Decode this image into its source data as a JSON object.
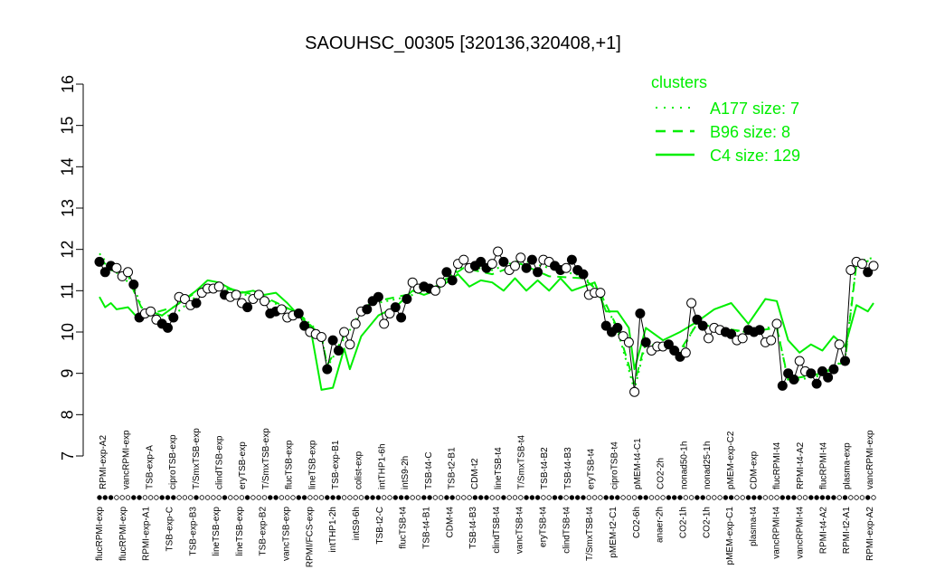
{
  "chart_data": {
    "type": "line",
    "title": "SAOUHSC_00305 [320136,320408,+1]",
    "xlabel": "",
    "ylabel": "",
    "ylim": [
      7,
      16
    ],
    "yticks": [
      "7",
      "8",
      "9",
      "10",
      "11",
      "12",
      "13",
      "14",
      "15",
      "16"
    ],
    "grid": false,
    "legend": {
      "placement": "top-right",
      "title": "clusters",
      "entries": [
        {
          "label": "A177 size: 7",
          "style": "dotted"
        },
        {
          "label": "B96 size: 8",
          "style": "dashed"
        },
        {
          "label": "C4 size: 129",
          "style": "solid"
        }
      ]
    },
    "colors": {
      "series": "#00ee00",
      "points_filled": "#000000",
      "points_open": "#ffffff"
    },
    "top_labels": [
      "RPMI-exp-A2",
      "vancRPMI-exp",
      "TSB-exp-A",
      "ciproTSB-exp",
      "T/SmxTSB-exp",
      "clindTSB-exp",
      "eryTSB-exp",
      "T/SmxTSB-exp",
      "flucTSB-exp",
      "lineTSB-exp",
      "TSB-exp-B1",
      "colist-exp",
      "intTHP1-6h",
      "intS9-2h",
      "TSB-t4-C",
      "TSB-t2-B1",
      "CDM-t2",
      "lineTSB-t4",
      "T/SmxTSB-t4",
      "TSB-t4-B2",
      "TSB-t4-B3",
      "eryTSB-t4",
      "ciproTSB-t4",
      "pMEM-t4-C1",
      "CO2-2h",
      "nonad50-1h",
      "nonad25-1h",
      "pMEM-exp-C2",
      "CDM-exp",
      "flucRPMI-t4",
      "RPMI-t4-A2",
      "flucRPMI-t4",
      "plasma-exp",
      "vancRPMI-exp"
    ],
    "bottom_labels": [
      "flucRPMI-exp",
      "flucRPMI-exp",
      "RPMI-exp-A1",
      "TSB-exp-C",
      "TSB-exp-B3",
      "lineTSB-exp",
      "lineTSB-exp",
      "TSB-exp-B2",
      "vancTSB-exp",
      "RPMI/FCS-exp",
      "intTHP1-2h",
      "intS9-6h",
      "TSB-t2-C",
      "flucTSB-t4",
      "TSB-t4-B1",
      "CDM-t4",
      "TSB-t4-B3",
      "clindTSB-t4",
      "vancTSB-t4",
      "eryTSB-t4",
      "clindTSB-t4",
      "T/SmxTSB-t4",
      "pMEM-t2-C1",
      "CO2-6h",
      "anaer-2h",
      "CO2-1h",
      "CO2-1h",
      "pMEM-exp-C1",
      "plasma-t4",
      "vancRPMI-t4",
      "vancRPMI-t4",
      "RPMI-t4-A2",
      "RPMI-t2-A1",
      "RPMI-exp-A2"
    ],
    "points": [
      {
        "x": 1,
        "y": 11.7,
        "f": 1
      },
      {
        "x": 2,
        "y": 11.45,
        "f": 1
      },
      {
        "x": 3,
        "y": 11.6,
        "f": 1
      },
      {
        "x": 4,
        "y": 11.55,
        "f": 0
      },
      {
        "x": 5,
        "y": 11.35,
        "f": 0
      },
      {
        "x": 6,
        "y": 11.45,
        "f": 0
      },
      {
        "x": 7,
        "y": 11.15,
        "f": 1
      },
      {
        "x": 8,
        "y": 10.35,
        "f": 1
      },
      {
        "x": 9,
        "y": 10.45,
        "f": 0
      },
      {
        "x": 10,
        "y": 10.5,
        "f": 0
      },
      {
        "x": 11,
        "y": 10.3,
        "f": 0
      },
      {
        "x": 12,
        "y": 10.2,
        "f": 1
      },
      {
        "x": 13,
        "y": 10.1,
        "f": 1
      },
      {
        "x": 14,
        "y": 10.35,
        "f": 1
      },
      {
        "x": 15,
        "y": 10.85,
        "f": 0
      },
      {
        "x": 16,
        "y": 10.8,
        "f": 0
      },
      {
        "x": 17,
        "y": 10.65,
        "f": 0
      },
      {
        "x": 18,
        "y": 10.7,
        "f": 1
      },
      {
        "x": 19,
        "y": 10.95,
        "f": 0
      },
      {
        "x": 20,
        "y": 11.05,
        "f": 0
      },
      {
        "x": 21,
        "y": 11.05,
        "f": 0
      },
      {
        "x": 22,
        "y": 11.1,
        "f": 0
      },
      {
        "x": 23,
        "y": 10.9,
        "f": 1
      },
      {
        "x": 24,
        "y": 10.85,
        "f": 0
      },
      {
        "x": 25,
        "y": 10.9,
        "f": 0
      },
      {
        "x": 26,
        "y": 10.7,
        "f": 0
      },
      {
        "x": 27,
        "y": 10.6,
        "f": 1
      },
      {
        "x": 28,
        "y": 10.8,
        "f": 0
      },
      {
        "x": 29,
        "y": 10.9,
        "f": 0
      },
      {
        "x": 30,
        "y": 10.75,
        "f": 0
      },
      {
        "x": 31,
        "y": 10.45,
        "f": 1
      },
      {
        "x": 32,
        "y": 10.5,
        "f": 1
      },
      {
        "x": 33,
        "y": 10.55,
        "f": 0
      },
      {
        "x": 34,
        "y": 10.35,
        "f": 0
      },
      {
        "x": 35,
        "y": 10.4,
        "f": 0
      },
      {
        "x": 36,
        "y": 10.45,
        "f": 1
      },
      {
        "x": 37,
        "y": 10.15,
        "f": 1
      },
      {
        "x": 38,
        "y": 10.0,
        "f": 0
      },
      {
        "x": 39,
        "y": 9.95,
        "f": 0
      },
      {
        "x": 40,
        "y": 9.88,
        "f": 0
      },
      {
        "x": 41,
        "y": 9.1,
        "f": 1
      },
      {
        "x": 42,
        "y": 9.8,
        "f": 1
      },
      {
        "x": 43,
        "y": 9.55,
        "f": 1
      },
      {
        "x": 44,
        "y": 10.0,
        "f": 0
      },
      {
        "x": 45,
        "y": 9.7,
        "f": 0
      },
      {
        "x": 46,
        "y": 10.2,
        "f": 0
      },
      {
        "x": 47,
        "y": 10.5,
        "f": 0
      },
      {
        "x": 48,
        "y": 10.55,
        "f": 1
      },
      {
        "x": 49,
        "y": 10.75,
        "f": 1
      },
      {
        "x": 50,
        "y": 10.85,
        "f": 1
      },
      {
        "x": 51,
        "y": 10.2,
        "f": 0
      },
      {
        "x": 52,
        "y": 10.45,
        "f": 0
      },
      {
        "x": 53,
        "y": 10.6,
        "f": 1
      },
      {
        "x": 54,
        "y": 10.35,
        "f": 1
      },
      {
        "x": 55,
        "y": 10.8,
        "f": 1
      },
      {
        "x": 56,
        "y": 11.2,
        "f": 0
      },
      {
        "x": 57,
        "y": 11.05,
        "f": 0
      },
      {
        "x": 58,
        "y": 11.1,
        "f": 1
      },
      {
        "x": 59,
        "y": 11.05,
        "f": 1
      },
      {
        "x": 60,
        "y": 11.0,
        "f": 0
      },
      {
        "x": 61,
        "y": 11.2,
        "f": 0
      },
      {
        "x": 62,
        "y": 11.45,
        "f": 1
      },
      {
        "x": 63,
        "y": 11.25,
        "f": 1
      },
      {
        "x": 64,
        "y": 11.65,
        "f": 0
      },
      {
        "x": 65,
        "y": 11.75,
        "f": 0
      },
      {
        "x": 66,
        "y": 11.55,
        "f": 0
      },
      {
        "x": 67,
        "y": 11.6,
        "f": 1
      },
      {
        "x": 68,
        "y": 11.7,
        "f": 1
      },
      {
        "x": 69,
        "y": 11.55,
        "f": 1
      },
      {
        "x": 70,
        "y": 11.65,
        "f": 0
      },
      {
        "x": 71,
        "y": 11.95,
        "f": 0
      },
      {
        "x": 72,
        "y": 11.7,
        "f": 1
      },
      {
        "x": 73,
        "y": 11.5,
        "f": 0
      },
      {
        "x": 74,
        "y": 11.6,
        "f": 0
      },
      {
        "x": 75,
        "y": 11.8,
        "f": 0
      },
      {
        "x": 76,
        "y": 11.55,
        "f": 1
      },
      {
        "x": 77,
        "y": 11.75,
        "f": 1
      },
      {
        "x": 78,
        "y": 11.45,
        "f": 1
      },
      {
        "x": 79,
        "y": 11.75,
        "f": 0
      },
      {
        "x": 80,
        "y": 11.7,
        "f": 0
      },
      {
        "x": 81,
        "y": 11.6,
        "f": 1
      },
      {
        "x": 82,
        "y": 11.5,
        "f": 1
      },
      {
        "x": 83,
        "y": 11.55,
        "f": 0
      },
      {
        "x": 84,
        "y": 11.75,
        "f": 1
      },
      {
        "x": 85,
        "y": 11.5,
        "f": 1
      },
      {
        "x": 86,
        "y": 11.4,
        "f": 1
      },
      {
        "x": 87,
        "y": 10.9,
        "f": 0
      },
      {
        "x": 88,
        "y": 10.95,
        "f": 0
      },
      {
        "x": 89,
        "y": 10.95,
        "f": 0
      },
      {
        "x": 90,
        "y": 10.15,
        "f": 1
      },
      {
        "x": 91,
        "y": 10.0,
        "f": 1
      },
      {
        "x": 92,
        "y": 10.1,
        "f": 1
      },
      {
        "x": 93,
        "y": 9.9,
        "f": 0
      },
      {
        "x": 94,
        "y": 9.75,
        "f": 0
      },
      {
        "x": 95,
        "y": 8.55,
        "f": 0
      },
      {
        "x": 96,
        "y": 10.45,
        "f": 1
      },
      {
        "x": 97,
        "y": 9.75,
        "f": 1
      },
      {
        "x": 98,
        "y": 9.55,
        "f": 0
      },
      {
        "x": 99,
        "y": 9.65,
        "f": 0
      },
      {
        "x": 100,
        "y": 9.65,
        "f": 0
      },
      {
        "x": 101,
        "y": 9.7,
        "f": 1
      },
      {
        "x": 102,
        "y": 9.55,
        "f": 1
      },
      {
        "x": 103,
        "y": 9.4,
        "f": 1
      },
      {
        "x": 104,
        "y": 9.5,
        "f": 0
      },
      {
        "x": 105,
        "y": 10.7,
        "f": 0
      },
      {
        "x": 106,
        "y": 10.3,
        "f": 1
      },
      {
        "x": 107,
        "y": 10.15,
        "f": 1
      },
      {
        "x": 108,
        "y": 9.85,
        "f": 0
      },
      {
        "x": 109,
        "y": 10.1,
        "f": 0
      },
      {
        "x": 110,
        "y": 10.05,
        "f": 0
      },
      {
        "x": 111,
        "y": 10.0,
        "f": 1
      },
      {
        "x": 112,
        "y": 9.95,
        "f": 1
      },
      {
        "x": 113,
        "y": 9.8,
        "f": 0
      },
      {
        "x": 114,
        "y": 9.85,
        "f": 0
      },
      {
        "x": 115,
        "y": 10.05,
        "f": 1
      },
      {
        "x": 116,
        "y": 10.0,
        "f": 1
      },
      {
        "x": 117,
        "y": 10.05,
        "f": 1
      },
      {
        "x": 118,
        "y": 9.75,
        "f": 0
      },
      {
        "x": 119,
        "y": 9.8,
        "f": 0
      },
      {
        "x": 120,
        "y": 10.2,
        "f": 0
      },
      {
        "x": 121,
        "y": 8.7,
        "f": 1
      },
      {
        "x": 122,
        "y": 9.0,
        "f": 1
      },
      {
        "x": 123,
        "y": 8.85,
        "f": 1
      },
      {
        "x": 124,
        "y": 9.3,
        "f": 0
      },
      {
        "x": 125,
        "y": 9.05,
        "f": 0
      },
      {
        "x": 126,
        "y": 9.0,
        "f": 1
      },
      {
        "x": 127,
        "y": 8.75,
        "f": 1
      },
      {
        "x": 128,
        "y": 9.05,
        "f": 1
      },
      {
        "x": 129,
        "y": 8.9,
        "f": 1
      },
      {
        "x": 130,
        "y": 9.1,
        "f": 1
      },
      {
        "x": 131,
        "y": 9.7,
        "f": 0
      },
      {
        "x": 132,
        "y": 9.3,
        "f": 1
      },
      {
        "x": 133,
        "y": 11.5,
        "f": 0
      },
      {
        "x": 134,
        "y": 11.7,
        "f": 0
      },
      {
        "x": 135,
        "y": 11.65,
        "f": 0
      },
      {
        "x": 136,
        "y": 11.45,
        "f": 1
      },
      {
        "x": 137,
        "y": 11.6,
        "f": 0
      }
    ],
    "series": [
      {
        "name": "C4 size: 129",
        "style": "solid",
        "points": [
          [
            1,
            10.85
          ],
          [
            2,
            10.6
          ],
          [
            3,
            10.7
          ],
          [
            4,
            10.55
          ],
          [
            6,
            10.6
          ],
          [
            8,
            10.3
          ],
          [
            10,
            10.5
          ],
          [
            12,
            10.4
          ],
          [
            14,
            10.6
          ],
          [
            16,
            10.8
          ],
          [
            18,
            11.0
          ],
          [
            20,
            11.25
          ],
          [
            22,
            11.2
          ],
          [
            24,
            11.05
          ],
          [
            26,
            10.95
          ],
          [
            28,
            11.0
          ],
          [
            30,
            10.9
          ],
          [
            32,
            10.95
          ],
          [
            34,
            10.7
          ],
          [
            36,
            10.4
          ],
          [
            38,
            10.15
          ],
          [
            40,
            8.6
          ],
          [
            42,
            8.65
          ],
          [
            44,
            9.6
          ],
          [
            45,
            9.1
          ],
          [
            47,
            9.9
          ],
          [
            50,
            10.4
          ],
          [
            53,
            10.6
          ],
          [
            56,
            11.0
          ],
          [
            58,
            10.9
          ],
          [
            60,
            11.0
          ],
          [
            62,
            11.2
          ],
          [
            64,
            11.4
          ],
          [
            66,
            11.1
          ],
          [
            68,
            11.25
          ],
          [
            70,
            11.2
          ],
          [
            72,
            11.0
          ],
          [
            74,
            11.3
          ],
          [
            76,
            11.0
          ],
          [
            78,
            11.25
          ],
          [
            80,
            11.0
          ],
          [
            82,
            11.3
          ],
          [
            84,
            11.0
          ],
          [
            86,
            11.1
          ],
          [
            88,
            11.2
          ],
          [
            90,
            10.5
          ],
          [
            92,
            10.5
          ],
          [
            94,
            10.1
          ],
          [
            95,
            9.1
          ],
          [
            97,
            10.1
          ],
          [
            100,
            9.8
          ],
          [
            103,
            10.0
          ],
          [
            106,
            10.25
          ],
          [
            109,
            10.55
          ],
          [
            112,
            10.7
          ],
          [
            115,
            10.2
          ],
          [
            118,
            10.8
          ],
          [
            120,
            10.75
          ],
          [
            122,
            9.8
          ],
          [
            124,
            9.5
          ],
          [
            126,
            9.7
          ],
          [
            128,
            9.55
          ],
          [
            130,
            9.9
          ],
          [
            132,
            9.65
          ],
          [
            134,
            10.65
          ],
          [
            136,
            10.5
          ],
          [
            137,
            10.7
          ]
        ]
      },
      {
        "name": "B96 size: 8",
        "style": "dashed",
        "points": [
          [
            1,
            11.8
          ],
          [
            3,
            11.5
          ],
          [
            6,
            11.4
          ],
          [
            7,
            11.0
          ],
          [
            9,
            10.4
          ],
          [
            14,
            10.6
          ],
          [
            20,
            11.15
          ],
          [
            25,
            11.0
          ],
          [
            30,
            10.85
          ],
          [
            36,
            10.45
          ],
          [
            40,
            9.9
          ],
          [
            41,
            9.2
          ],
          [
            44,
            9.9
          ],
          [
            48,
            10.7
          ],
          [
            55,
            10.9
          ],
          [
            60,
            11.1
          ],
          [
            65,
            11.55
          ],
          [
            70,
            11.4
          ],
          [
            75,
            11.65
          ],
          [
            80,
            11.35
          ],
          [
            86,
            11.3
          ],
          [
            89,
            10.95
          ],
          [
            92,
            10.1
          ],
          [
            95,
            8.75
          ],
          [
            97,
            9.8
          ],
          [
            103,
            9.55
          ],
          [
            106,
            10.2
          ],
          [
            110,
            10.1
          ],
          [
            115,
            10.0
          ],
          [
            120,
            10.1
          ],
          [
            122,
            8.85
          ],
          [
            128,
            9.0
          ],
          [
            132,
            9.3
          ],
          [
            134,
            11.65
          ],
          [
            137,
            11.75
          ]
        ]
      },
      {
        "name": "A177 size: 7",
        "style": "dotted",
        "points": [
          [
            1,
            11.9
          ],
          [
            3,
            11.55
          ],
          [
            7,
            11.1
          ],
          [
            9,
            10.4
          ],
          [
            14,
            10.4
          ],
          [
            20,
            11.1
          ],
          [
            25,
            10.95
          ],
          [
            30,
            10.8
          ],
          [
            36,
            10.45
          ],
          [
            40,
            9.95
          ],
          [
            41,
            9.15
          ],
          [
            44,
            9.85
          ],
          [
            48,
            10.65
          ],
          [
            55,
            10.85
          ],
          [
            60,
            11.1
          ],
          [
            65,
            11.6
          ],
          [
            70,
            11.5
          ],
          [
            75,
            11.75
          ],
          [
            80,
            11.55
          ],
          [
            86,
            11.35
          ],
          [
            89,
            10.95
          ],
          [
            92,
            10.05
          ],
          [
            95,
            8.6
          ],
          [
            97,
            9.75
          ],
          [
            103,
            9.45
          ],
          [
            106,
            10.25
          ],
          [
            110,
            10.05
          ],
          [
            115,
            10.0
          ],
          [
            120,
            10.15
          ],
          [
            122,
            8.8
          ],
          [
            128,
            8.95
          ],
          [
            132,
            9.35
          ],
          [
            134,
            11.7
          ],
          [
            137,
            11.8
          ]
        ]
      }
    ]
  }
}
